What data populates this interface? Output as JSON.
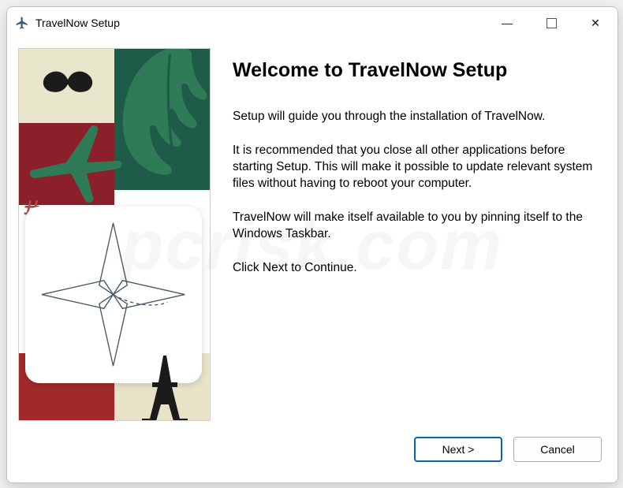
{
  "window": {
    "title": "TravelNow Setup"
  },
  "titlebar": {
    "minimize_symbol": "—",
    "close_symbol": "✕"
  },
  "content": {
    "heading": "Welcome to TravelNow Setup",
    "para1": "Setup will guide you through the installation of TravelNow.",
    "para2": "It is recommended that you close all other applications before starting Setup.  This will make it possible to update relevant system files without having to reboot your computer.",
    "para3": "TravelNow will make itself available to you by pinning itself to the Windows Taskbar.",
    "para4": "Click Next to Continue."
  },
  "buttons": {
    "next": "Next >",
    "cancel": "Cancel"
  },
  "watermark": "pcrisk.com",
  "icons": {
    "app": "airplane-icon"
  }
}
